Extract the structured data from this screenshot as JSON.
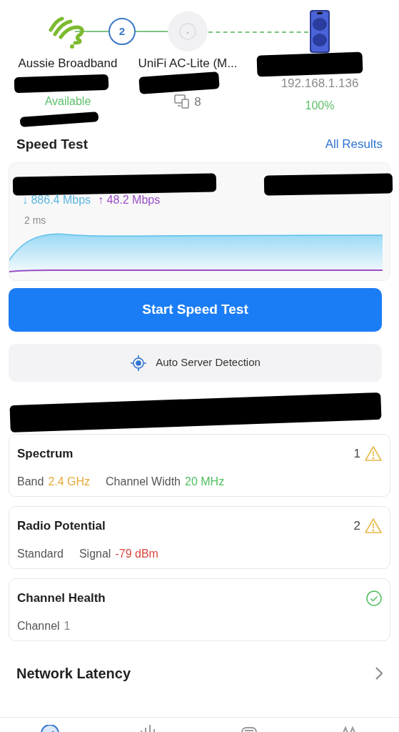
{
  "topology": [
    {
      "kind": "isp",
      "label": "Aussie Broadband",
      "status": "Available"
    },
    {
      "kind": "hop",
      "label": "2"
    },
    {
      "kind": "ap",
      "label": "UniFi AC-Lite (M...",
      "clients": "8"
    },
    {
      "kind": "phone",
      "ip": "192.168.1.136",
      "status": "100%"
    }
  ],
  "speed_test": {
    "title": "Speed Test",
    "link": "All Results",
    "download": "↓ 886.4 Mbps",
    "upload": "↑ 48.2 Mbps",
    "latency": "2 ms",
    "button": "Start Speed Test",
    "server": "Auto Server Detection"
  },
  "cards": [
    {
      "title": "Spectrum",
      "count": "1",
      "kind": "warning",
      "fields": [
        {
          "label": "Band",
          "value": "2.4 GHz",
          "color": "#e8a838"
        },
        {
          "label": "Channel Width",
          "value": "20 MHz",
          "color": "#4fbf5f"
        }
      ]
    },
    {
      "title": "Radio Potential",
      "count": "2",
      "kind": "warning",
      "fields": [
        {
          "label": "Standard"
        },
        {
          "label": "Signal",
          "value": "-79 dBm",
          "color": "#d9463f"
        }
      ]
    },
    {
      "title": "Channel Health",
      "kind": "ok",
      "fields": [
        {
          "label": "Channel",
          "value": "1",
          "color": "#8a8a8a"
        }
      ]
    }
  ],
  "latency_row": {
    "title": "Network Latency"
  },
  "tab_bar": [
    {
      "selected": true
    },
    {
      "selected": false
    },
    {
      "selected": false
    },
    {
      "selected": false
    }
  ]
}
